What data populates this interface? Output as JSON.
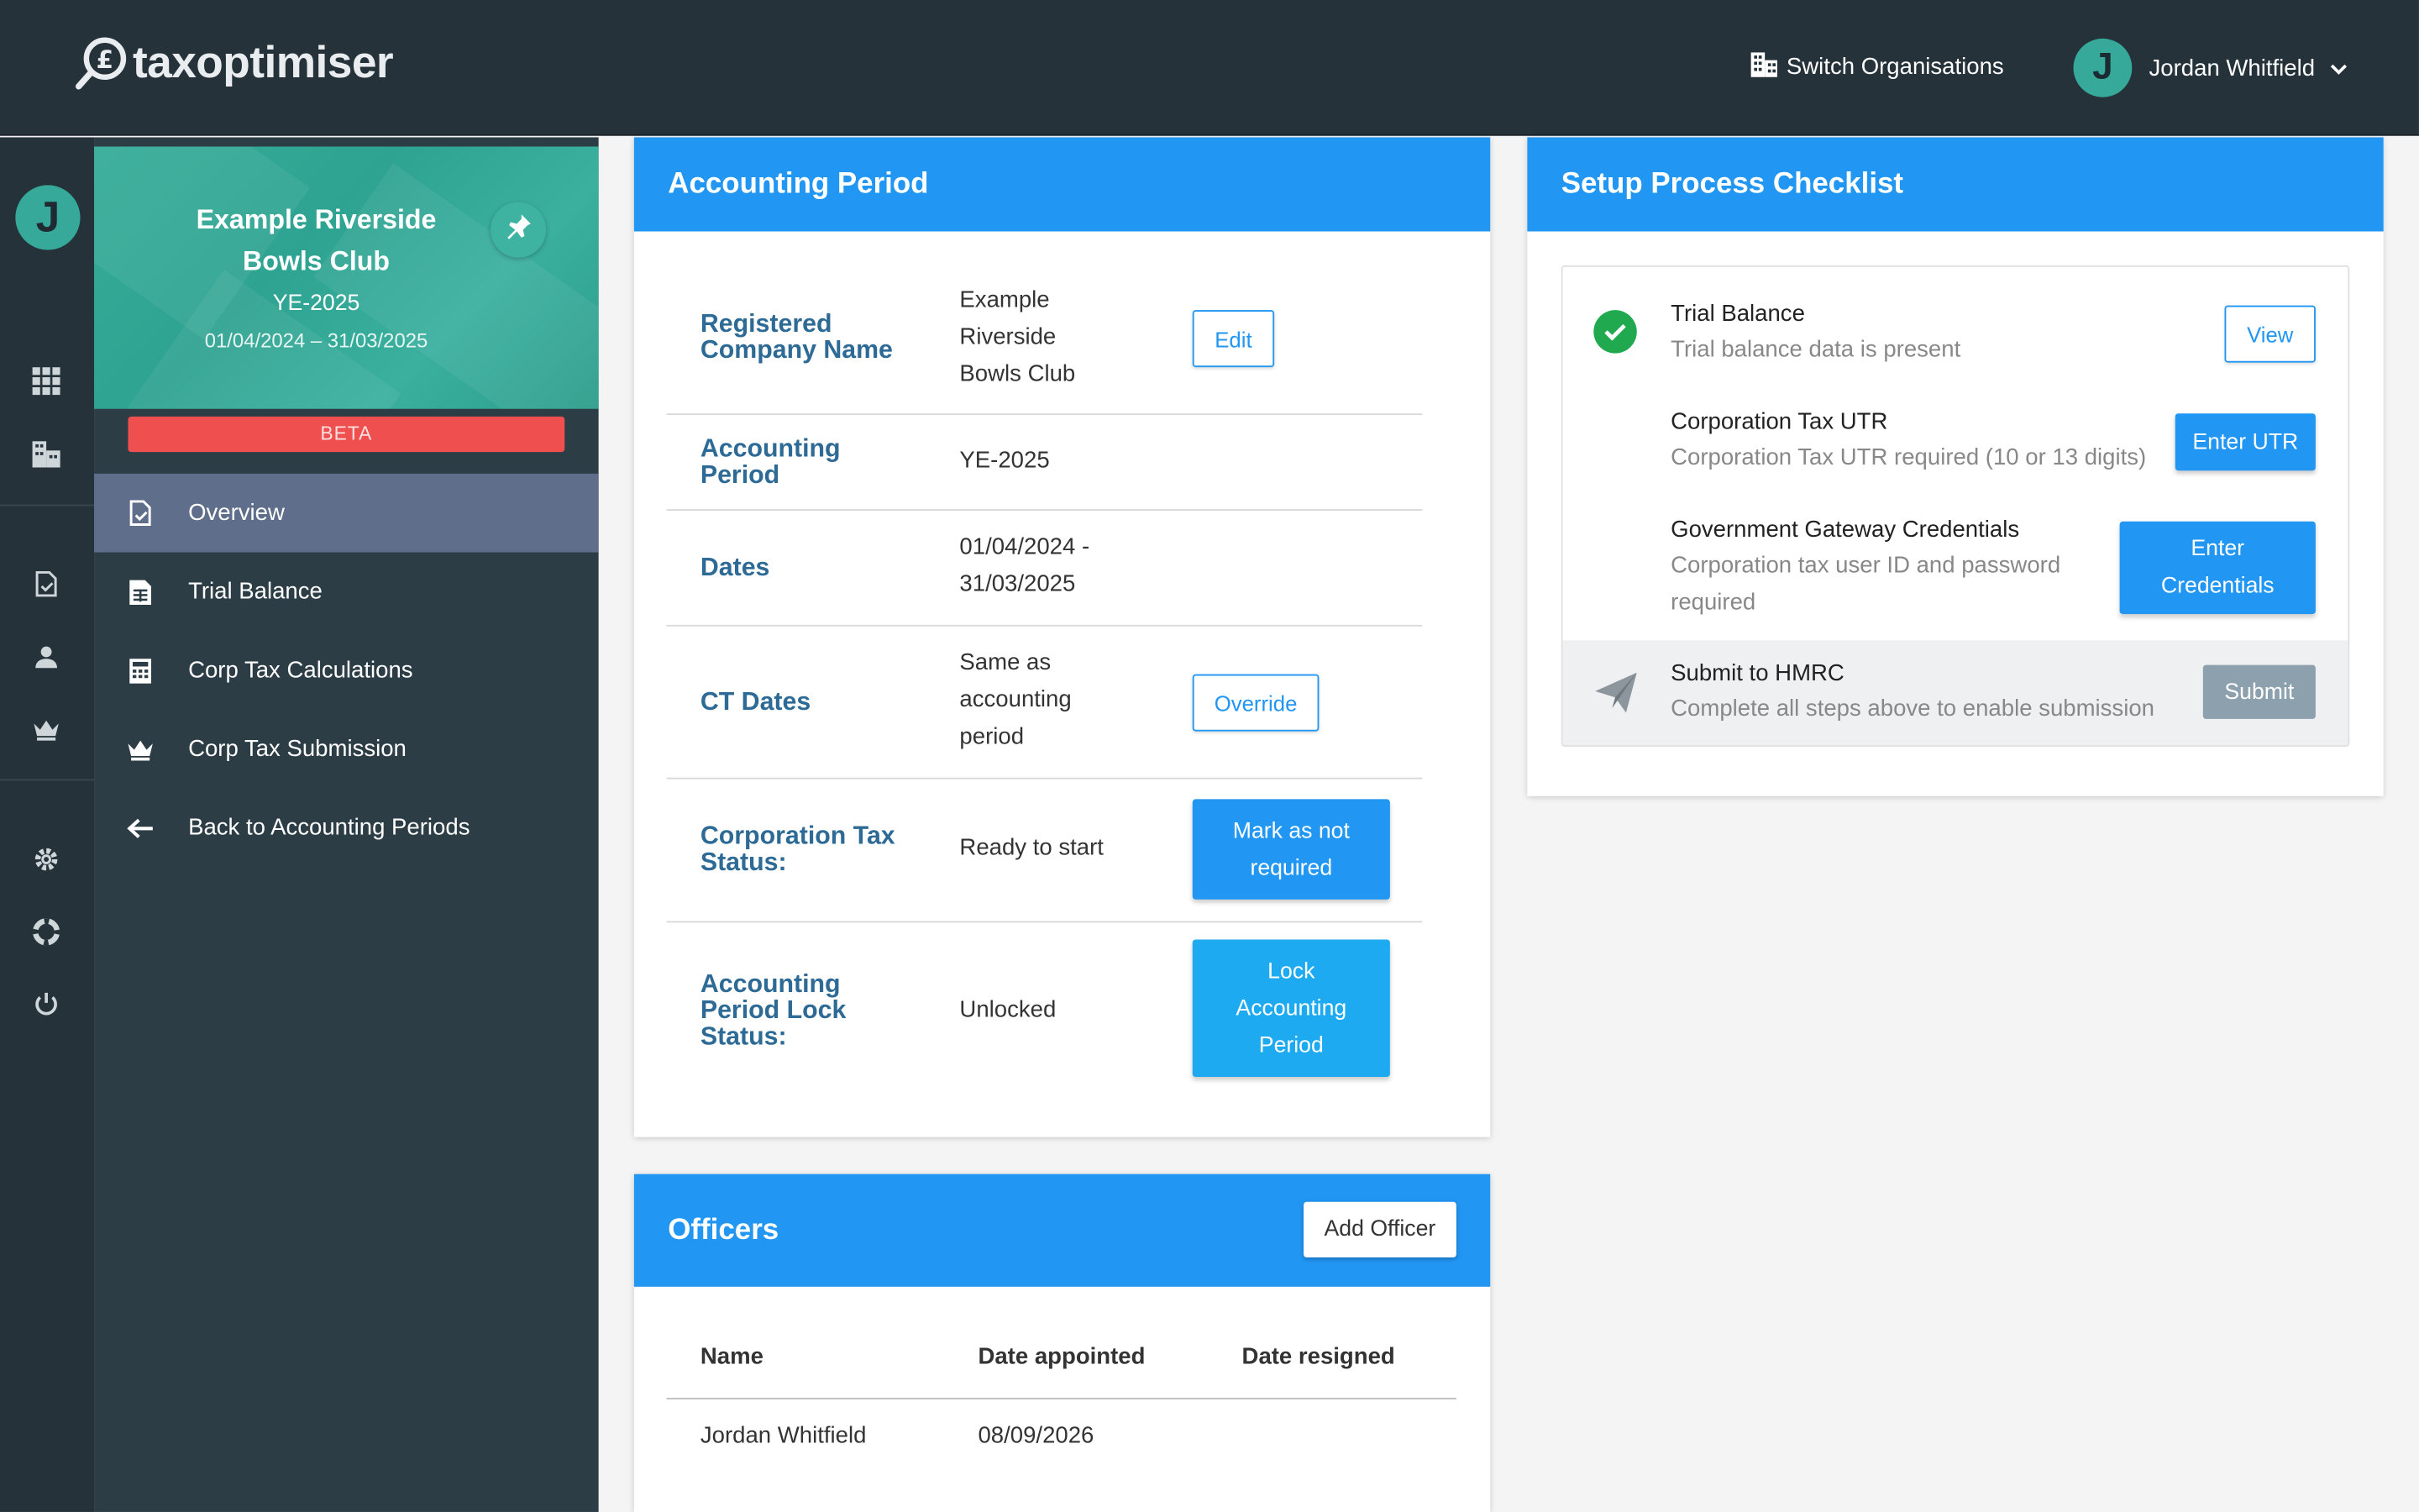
{
  "app": {
    "brand": "taxoptimiser"
  },
  "topbar": {
    "switch_org_label": "Switch Organisations",
    "user_name": "Jordan Whitfield",
    "user_initial": "J"
  },
  "rail": {
    "avatar_initial": "J"
  },
  "org": {
    "name": "Example Riverside Bowls Club",
    "period": "YE-2025",
    "dates": "01/04/2024 – 31/03/2025",
    "beta_label": "BETA"
  },
  "nav": {
    "items": [
      {
        "label": "Overview",
        "icon": "document-check-icon"
      },
      {
        "label": "Trial Balance",
        "icon": "spreadsheet-icon"
      },
      {
        "label": "Corp Tax Calculations",
        "icon": "calculator-icon"
      },
      {
        "label": "Corp Tax Submission",
        "icon": "crown-icon"
      },
      {
        "label": "Back to Accounting Periods",
        "icon": "arrow-left-icon"
      }
    ]
  },
  "accounting_period": {
    "title": "Accounting Period",
    "rows": [
      {
        "label": "Registered Company Name",
        "value_lines": [
          "Example",
          "Riverside",
          "Bowls Club"
        ],
        "button": "Edit"
      },
      {
        "label": "Accounting Period",
        "value_lines": [
          "YE-2025"
        ]
      },
      {
        "label": "Dates",
        "value_lines": [
          "01/04/2024 -",
          "31/03/2025"
        ]
      },
      {
        "label": "CT Dates",
        "value_lines": [
          "Same as",
          "accounting",
          "period"
        ],
        "button": "Override"
      },
      {
        "label": "Corporation Tax Status:",
        "value_lines": [
          "Ready to start"
        ],
        "button_lines": [
          "Mark as not",
          "required"
        ]
      },
      {
        "label": "Accounting Period Lock Status:",
        "value_lines": [
          "Unlocked"
        ],
        "button_lines": [
          "Lock",
          "Accounting",
          "Period"
        ]
      }
    ]
  },
  "officers": {
    "title": "Officers",
    "add_button": "Add Officer",
    "columns": [
      "Name",
      "Date appointed",
      "Date resigned"
    ],
    "rows": [
      {
        "name": "Jordan Whitfield",
        "appointed": "08/09/2026",
        "resigned": ""
      }
    ]
  },
  "setup": {
    "title": "Setup Process Checklist",
    "items": [
      {
        "title": "Trial Balance",
        "subtitle": "Trial balance data is present",
        "button": "View",
        "status": "complete"
      },
      {
        "title": "Corporation Tax UTR",
        "subtitle": "Corporation Tax UTR required (10 or 13 digits)",
        "button": "Enter UTR",
        "status": "pending"
      },
      {
        "title": "Government Gateway Credentials",
        "subtitle_lines": [
          "Corporation tax user ID and password",
          "required"
        ],
        "button_lines": [
          "Enter",
          "Credentials"
        ],
        "status": "pending"
      },
      {
        "title": "Submit to HMRC",
        "subtitle": "Complete all steps above to enable submission",
        "button": "Submit",
        "status": "disabled"
      }
    ]
  },
  "colors": {
    "topbar": "#25323a",
    "sidebar": "#2d3d46",
    "accent": "#2196f3",
    "teal": "#36a99a",
    "beta": "#ef4f4f",
    "success": "#20a94f",
    "active_nav": "#5f6e8a"
  }
}
